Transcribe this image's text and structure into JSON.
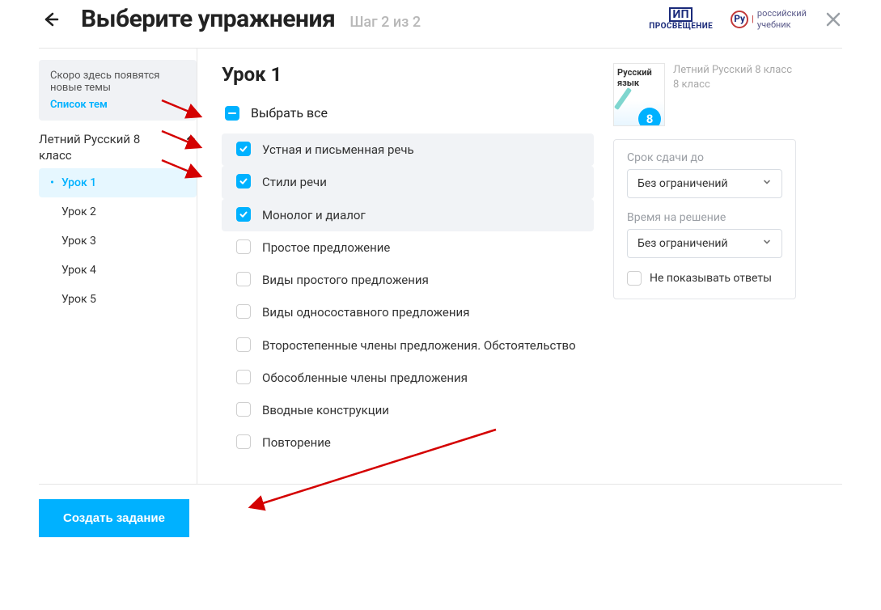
{
  "header": {
    "title": "Выберите упражнения",
    "step": "Шаг 2 из 2",
    "logo1_text": "ПРОСВЕЩЕНИЕ",
    "logo2_lines": "российский\nучебник"
  },
  "sidebar": {
    "promo_text": "Скоро здесь появятся новые темы",
    "promo_link": "Список тем",
    "course_name": "Летний Русский 8 класс",
    "lessons": [
      {
        "label": "Урок 1",
        "active": true
      },
      {
        "label": "Урок 2",
        "active": false
      },
      {
        "label": "Урок 3",
        "active": false
      },
      {
        "label": "Урок 4",
        "active": false
      },
      {
        "label": "Урок 5",
        "active": false
      }
    ]
  },
  "main": {
    "lesson_title": "Урок 1",
    "select_all_label": "Выбрать все",
    "exercises": [
      {
        "label": "Устная и письменная речь",
        "checked": true
      },
      {
        "label": "Стили речи",
        "checked": true
      },
      {
        "label": "Монолог и диалог",
        "checked": true
      },
      {
        "label": "Простое предложение",
        "checked": false
      },
      {
        "label": "Виды простого предложения",
        "checked": false
      },
      {
        "label": "Виды односоставного предложения",
        "checked": false
      },
      {
        "label": "Второстепенные члены предложения. Обстоятельство",
        "checked": false
      },
      {
        "label": "Обособленные члены предложения",
        "checked": false
      },
      {
        "label": "Вводные конструкции",
        "checked": false
      },
      {
        "label": "Повторение",
        "checked": false
      }
    ]
  },
  "right": {
    "cover_title": "Русский\nязык",
    "cover_num": "8",
    "course_title": "Летний Русский 8 класс",
    "course_grade": "8 класс",
    "deadline_label": "Срок сдачи до",
    "deadline_value": "Без ограничений",
    "time_label": "Время на решение",
    "time_value": "Без ограничений",
    "hide_answers_label": "Не показывать ответы"
  },
  "footer": {
    "create_btn": "Создать задание"
  }
}
